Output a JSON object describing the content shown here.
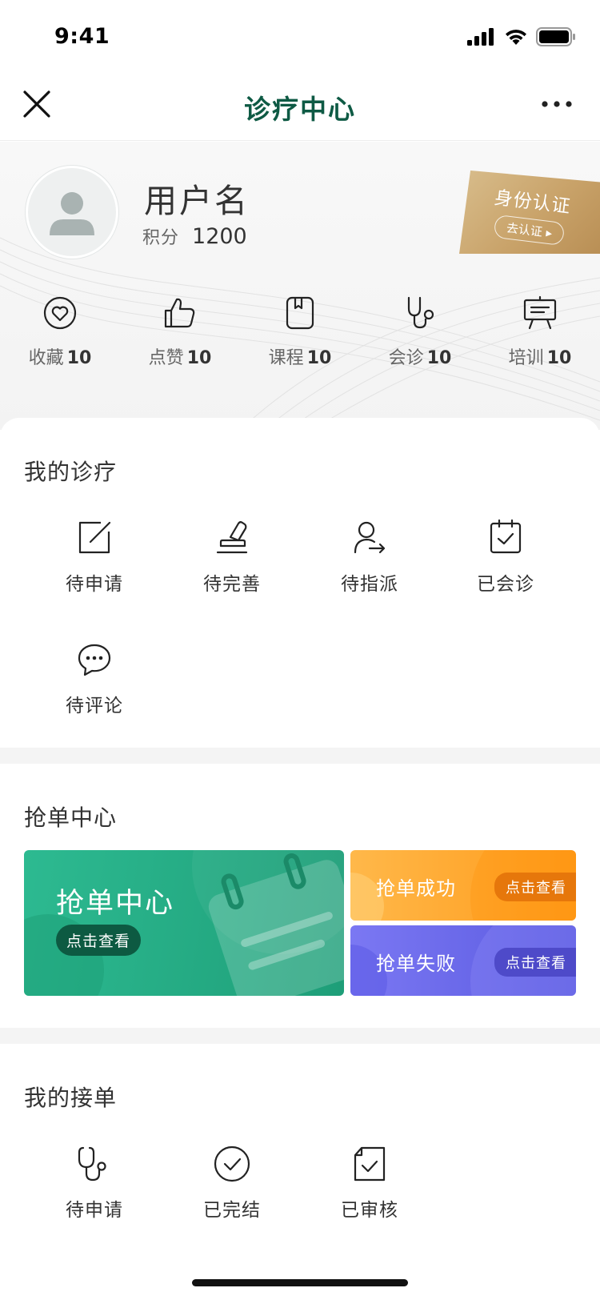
{
  "status_bar": {
    "time": "9:41"
  },
  "nav": {
    "title": "诊疗中心"
  },
  "profile": {
    "username": "用户名",
    "points_label": "积分",
    "points_value": "1200",
    "certification": {
      "title": "身份认证",
      "button": "去认证 ▸"
    },
    "stats": [
      {
        "label": "收藏",
        "count": "10",
        "icon": "heart-icon"
      },
      {
        "label": "点赞",
        "count": "10",
        "icon": "thumbs-up-icon"
      },
      {
        "label": "课程",
        "count": "10",
        "icon": "book-icon"
      },
      {
        "label": "会诊",
        "count": "10",
        "icon": "stethoscope-icon"
      },
      {
        "label": "培训",
        "count": "10",
        "icon": "presentation-board-icon"
      }
    ]
  },
  "my_treatment": {
    "title": "我的诊疗",
    "items": [
      {
        "label": "待申请",
        "icon": "edit-square-icon"
      },
      {
        "label": "待完善",
        "icon": "stamp-pen-icon"
      },
      {
        "label": "待指派",
        "icon": "user-assign-icon"
      },
      {
        "label": "已会诊",
        "icon": "clipboard-check-icon"
      },
      {
        "label": "待评论",
        "icon": "chat-bubble-icon"
      }
    ]
  },
  "grab_center": {
    "title": "抢单中心",
    "main_card": {
      "title": "抢单中心",
      "button": "点击查看"
    },
    "success_card": {
      "title": "抢单成功",
      "button": "点击查看"
    },
    "fail_card": {
      "title": "抢单失败",
      "button": "点击查看"
    }
  },
  "my_orders": {
    "title": "我的接单",
    "items": [
      {
        "label": "待申请",
        "icon": "stethoscope-icon"
      },
      {
        "label": "已完结",
        "icon": "check-circle-icon"
      },
      {
        "label": "已审核",
        "icon": "document-check-icon"
      }
    ]
  },
  "colors": {
    "brand_green": "#0e5a44",
    "card_green": "#2dba91",
    "card_orange": "#ff9b1a",
    "card_purple": "#5a5ae0",
    "gold": "#c9a36a"
  }
}
